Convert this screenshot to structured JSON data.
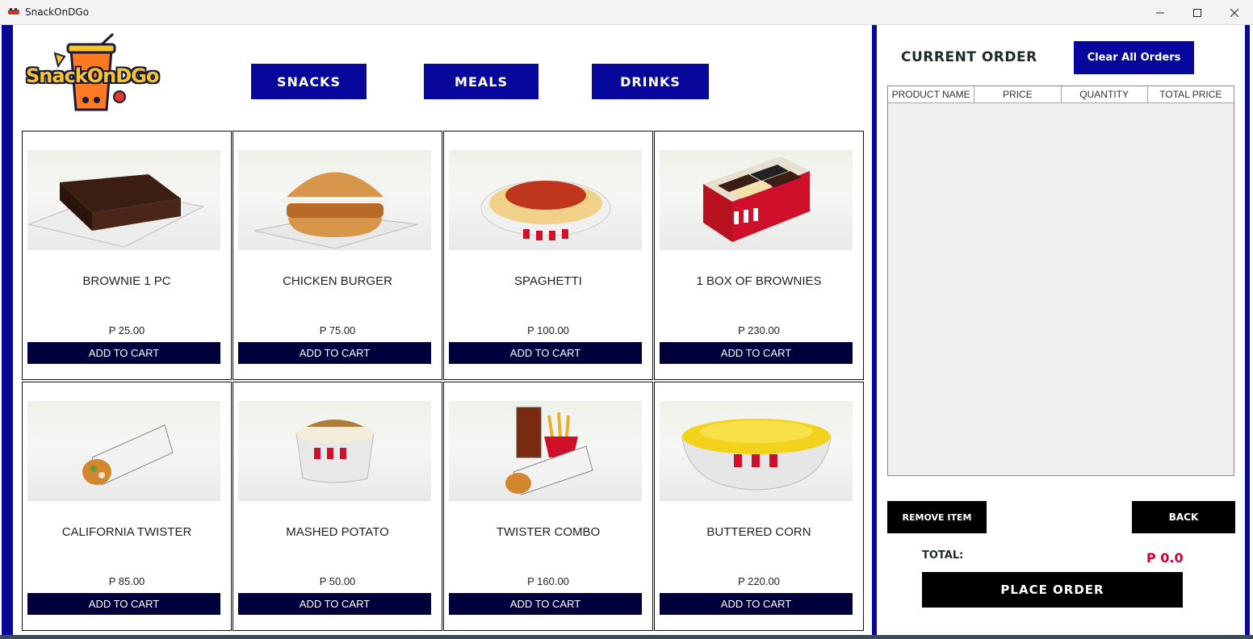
{
  "window": {
    "title": "SnackOnDGo"
  },
  "logo": {
    "text": "SnackOnDGo"
  },
  "categories": [
    {
      "label": "SNACKS"
    },
    {
      "label": "MEALS"
    },
    {
      "label": "DRINKS"
    }
  ],
  "products": [
    {
      "name": "BROWNIE 1 PC",
      "price": "P 25.00",
      "button": "ADD TO CART",
      "image": "brownie-slice"
    },
    {
      "name": "CHICKEN BURGER",
      "price": "P 75.00",
      "button": "ADD TO CART",
      "image": "chicken-burger"
    },
    {
      "name": "SPAGHETTI",
      "price": "P 100.00",
      "button": "ADD TO CART",
      "image": "spaghetti-bowl"
    },
    {
      "name": "1 BOX OF BROWNIES",
      "price": "P 230.00",
      "button": "ADD TO CART",
      "image": "brownie-box"
    },
    {
      "name": "CALIFORNIA TWISTER",
      "price": "P 85.00",
      "button": "ADD TO CART",
      "image": "twister-wrap"
    },
    {
      "name": "MASHED POTATO",
      "price": "P 50.00",
      "button": "ADD TO CART",
      "image": "mashed-potato-cup"
    },
    {
      "name": "TWISTER COMBO",
      "price": "P 160.00",
      "button": "ADD TO CART",
      "image": "twister-combo"
    },
    {
      "name": "BUTTERED CORN",
      "price": "P 220.00",
      "button": "ADD TO CART",
      "image": "corn-bowl"
    }
  ],
  "order": {
    "title": "CURRENT ORDER",
    "clear_label": "Clear All Orders",
    "columns": [
      "PRODUCT NAME",
      "PRICE",
      "QUANTITY",
      "TOTAL PRICE"
    ],
    "rows": [],
    "remove_label": "REMOVE ITEM",
    "back_label": "BACK",
    "total_label": "TOTAL:",
    "total_value": "P 0.0",
    "place_label": "PLACE ORDER"
  },
  "colors": {
    "frame_blue": "#07079b",
    "card_button": "#00003d",
    "total_red": "#d0003a"
  }
}
